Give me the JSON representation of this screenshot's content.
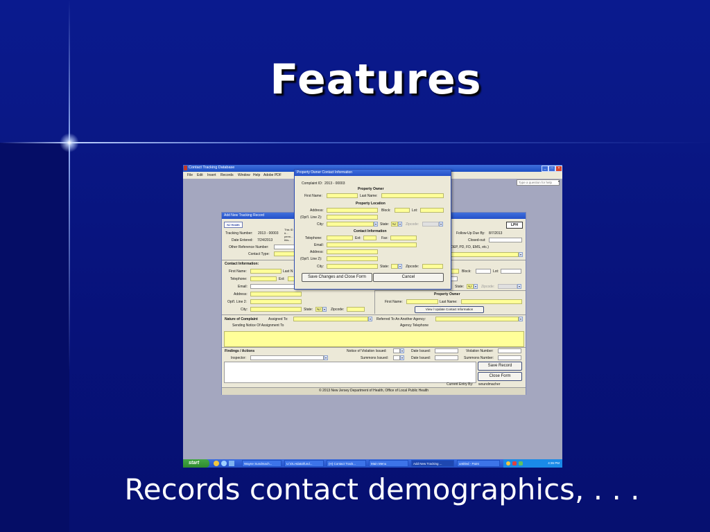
{
  "slide": {
    "title": "Features",
    "caption": "Records contact demographics, . . ."
  },
  "app": {
    "title": "Contact Tracking Database",
    "menus": [
      "File",
      "Edit",
      "Insert",
      "Records",
      "Window",
      "Help",
      "Adobe PDF"
    ],
    "help_placeholder": "Type a question for help"
  },
  "dialog": {
    "title": "Property Owner Contact Information",
    "complaint_id_label": "Complaint ID:",
    "complaint_id": "2013 -  00003",
    "owner_header": "Property Owner",
    "first_name_label": "First Name:",
    "last_name_label": "Last Name:",
    "location_header": "Property Location",
    "address_label": "Address:",
    "block_label": "Block:",
    "lot_label": "Lot:",
    "line2_label": "(Opt'l. Line 2):",
    "city_label": "City:",
    "state_label": "State:",
    "state_value": "NJ",
    "zip_label": "Zipcode:",
    "contact_header": "Contact Information",
    "telephone_label": "Telephone:",
    "ext_label": "Ext:",
    "fax_label": "Fax:",
    "email_label": "Email:",
    "state2_value": "",
    "save_button": "Save Changes and Close Form",
    "cancel_button": "Cancel"
  },
  "tracking": {
    "title": "Add New Tracking Record",
    "logo_left": "NJ Health",
    "logo_right": "LPH",
    "tracking_number_label": "Tracking Number:",
    "tracking_number": "2013 - 00003",
    "notice_text": "This ID #... perm... this... recor...",
    "date_entered_label": "Date Entered:",
    "date_entered": "7/24/2013",
    "other_ref_label": "Other Reference Number:",
    "contact_type_label": "Contact Type:",
    "followup_label": "Follow-Up Due By:",
    "followup_value": "8/7/2013",
    "closed_label": "Closed-out:",
    "agencies_text": "DEP, PD, FD, EMS, etc.)",
    "contact_info_header": "Contact Information:",
    "first_name_label": "First Name:",
    "last_name_label": "Last N",
    "telephone_label": "Telephone:",
    "ext_label": "Ext:",
    "email_label": "Email:",
    "address_label": "Address:",
    "line2_label": "Opt'l. Line 2:",
    "city_label": "City:",
    "state_label": "State:",
    "state_value": "NJ",
    "zip_label": "Zipcode:",
    "block_label": "Block:",
    "lot_label": "Lot:",
    "right_state_label": "State:",
    "right_state_value": "NJ",
    "right_zip_label": "Zipcode:",
    "owner_header": "Property Owner",
    "owner_first_label": "First Name:",
    "owner_last_label": "Last Name:",
    "view_update_button": "View / Update Contact Information",
    "nature_label": "Nature of Complaint",
    "assigned_label": "Assigned To:",
    "referred_label": "Referred To An Another Agency:",
    "sending_notice_label": "Sending Notice Of Assignment To",
    "agency_tel_label": "Agency Telephone",
    "findings_label": "Findings / Actions",
    "inspector_label": "Inspector:",
    "nov_label": "Notice of Violation Issued:",
    "summons_label": "Summons Issued:",
    "date_issued_label": "Date Issued:",
    "violation_number_label": "Violation Number:",
    "summons_number_label": "Summons Number:",
    "save_record_button": "Save Record",
    "close_form_button": "Close Form",
    "current_entry_label": "Current Entry By:",
    "current_entry_value": "woundmacher",
    "footer": "© 2013 New Jersey Department of Health, Office of Local Public Health"
  },
  "taskbar": {
    "start": "start",
    "tasks": [
      "Wayne Sundmach...",
      "U:\\OLHdata\\fund...",
      "(H) Contact Track...",
      "Main Menu",
      "Add New Tracking ...",
      "untitled - Paint"
    ],
    "clock": "4:36 PM"
  },
  "colors": {
    "slide_background": "#0a1a8e",
    "required_field": "#ffff99",
    "xp_titlebar": "#2450c8"
  }
}
